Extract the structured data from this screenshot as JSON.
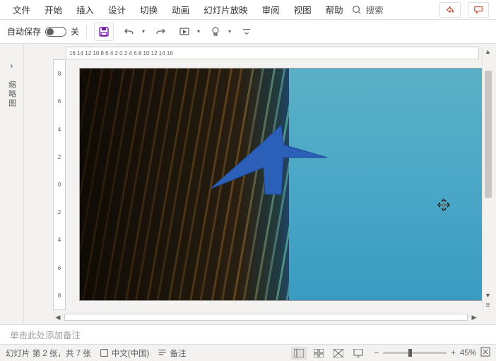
{
  "menubar": {
    "items": [
      "文件",
      "开始",
      "插入",
      "设计",
      "切换",
      "动画",
      "幻灯片放映",
      "审阅",
      "视图",
      "帮助"
    ],
    "search_label": "搜索"
  },
  "toolbar": {
    "autosave_label": "自动保存",
    "autosave_state": "关"
  },
  "ruler": {
    "h": "16  14  12  10  8  6  4  2  0  2  4  6  8  10  12  14  16",
    "v": [
      "8",
      "6",
      "4",
      "2",
      "0",
      "2",
      "4",
      "6",
      "8"
    ]
  },
  "outline": {
    "label": "缩略图"
  },
  "notes": {
    "placeholder": "单击此处添加备注"
  },
  "status": {
    "slide_label": "幻灯片 第 2 张，共 7 张",
    "language": "中文(中国)",
    "notes": "备注",
    "zoom_pct": "45%"
  }
}
